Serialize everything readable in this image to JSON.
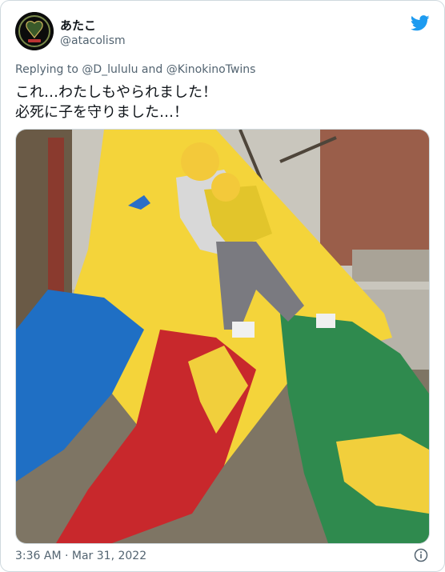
{
  "tweet": {
    "display_name": "あたこ",
    "handle": "@atacolism",
    "reply_prefix": "Replying to",
    "reply_mention_1": "@D_lululu",
    "reply_joiner": "and",
    "reply_mention_2": "@KinokinoTwins",
    "text_line_1": "これ…わたしもやられました！",
    "text_line_2": "必死に子を守りました…！",
    "timestamp": "3:36 AM · Mar 31, 2022"
  },
  "icons": {
    "bird": "twitter-bird-icon",
    "info": "info-icon"
  },
  "colors": {
    "twitter_blue": "#1d9bf0",
    "secondary_text": "#536471",
    "border": "#cfd9de"
  }
}
